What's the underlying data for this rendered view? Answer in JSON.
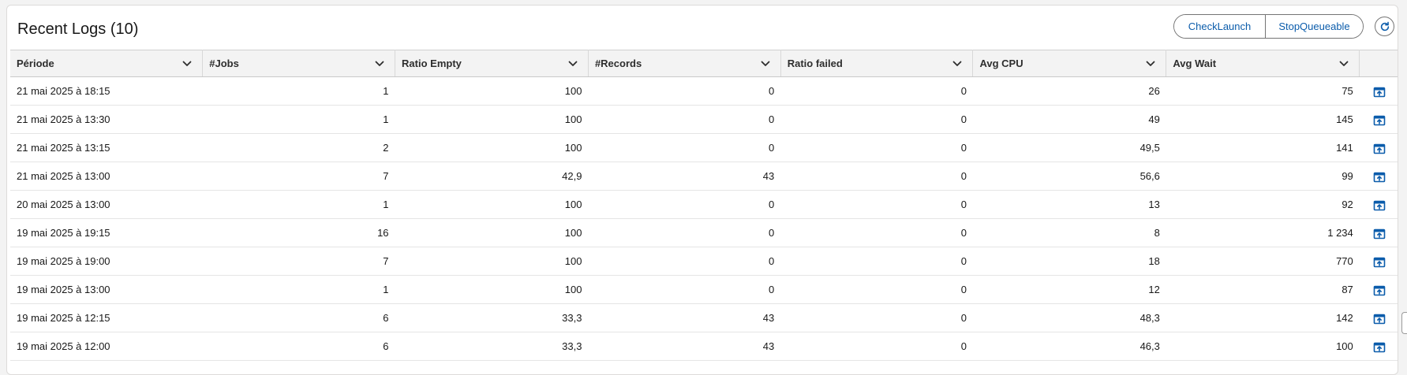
{
  "title": "Recent Logs (10)",
  "buttons": {
    "check_launch": "CheckLaunch",
    "stop_queueable": "StopQueueable"
  },
  "icons": {
    "refresh": "refresh-icon",
    "column_menu": "chevron-down-icon",
    "row_action": "open-record-icon"
  },
  "accent_color": "#0b5cab",
  "columns": [
    "Période",
    "#Jobs",
    "Ratio Empty",
    "#Records",
    "Ratio failed",
    "Avg CPU",
    "Avg Wait"
  ],
  "rows": [
    [
      "21 mai 2025 à 18:15",
      "1",
      "100",
      "0",
      "0",
      "26",
      "75"
    ],
    [
      "21 mai 2025 à 13:30",
      "1",
      "100",
      "0",
      "0",
      "49",
      "145"
    ],
    [
      "21 mai 2025 à 13:15",
      "2",
      "100",
      "0",
      "0",
      "49,5",
      "141"
    ],
    [
      "21 mai 2025 à 13:00",
      "7",
      "42,9",
      "43",
      "0",
      "56,6",
      "99"
    ],
    [
      "20 mai 2025 à 13:00",
      "1",
      "100",
      "0",
      "0",
      "13",
      "92"
    ],
    [
      "19 mai 2025 à 19:15",
      "16",
      "100",
      "0",
      "0",
      "8",
      "1 234"
    ],
    [
      "19 mai 2025 à 19:00",
      "7",
      "100",
      "0",
      "0",
      "18",
      "770"
    ],
    [
      "19 mai 2025 à 13:00",
      "1",
      "100",
      "0",
      "0",
      "12",
      "87"
    ],
    [
      "19 mai 2025 à 12:15",
      "6",
      "33,3",
      "43",
      "0",
      "48,3",
      "142"
    ],
    [
      "19 mai 2025 à 12:00",
      "6",
      "33,3",
      "43",
      "0",
      "46,3",
      "100"
    ]
  ]
}
